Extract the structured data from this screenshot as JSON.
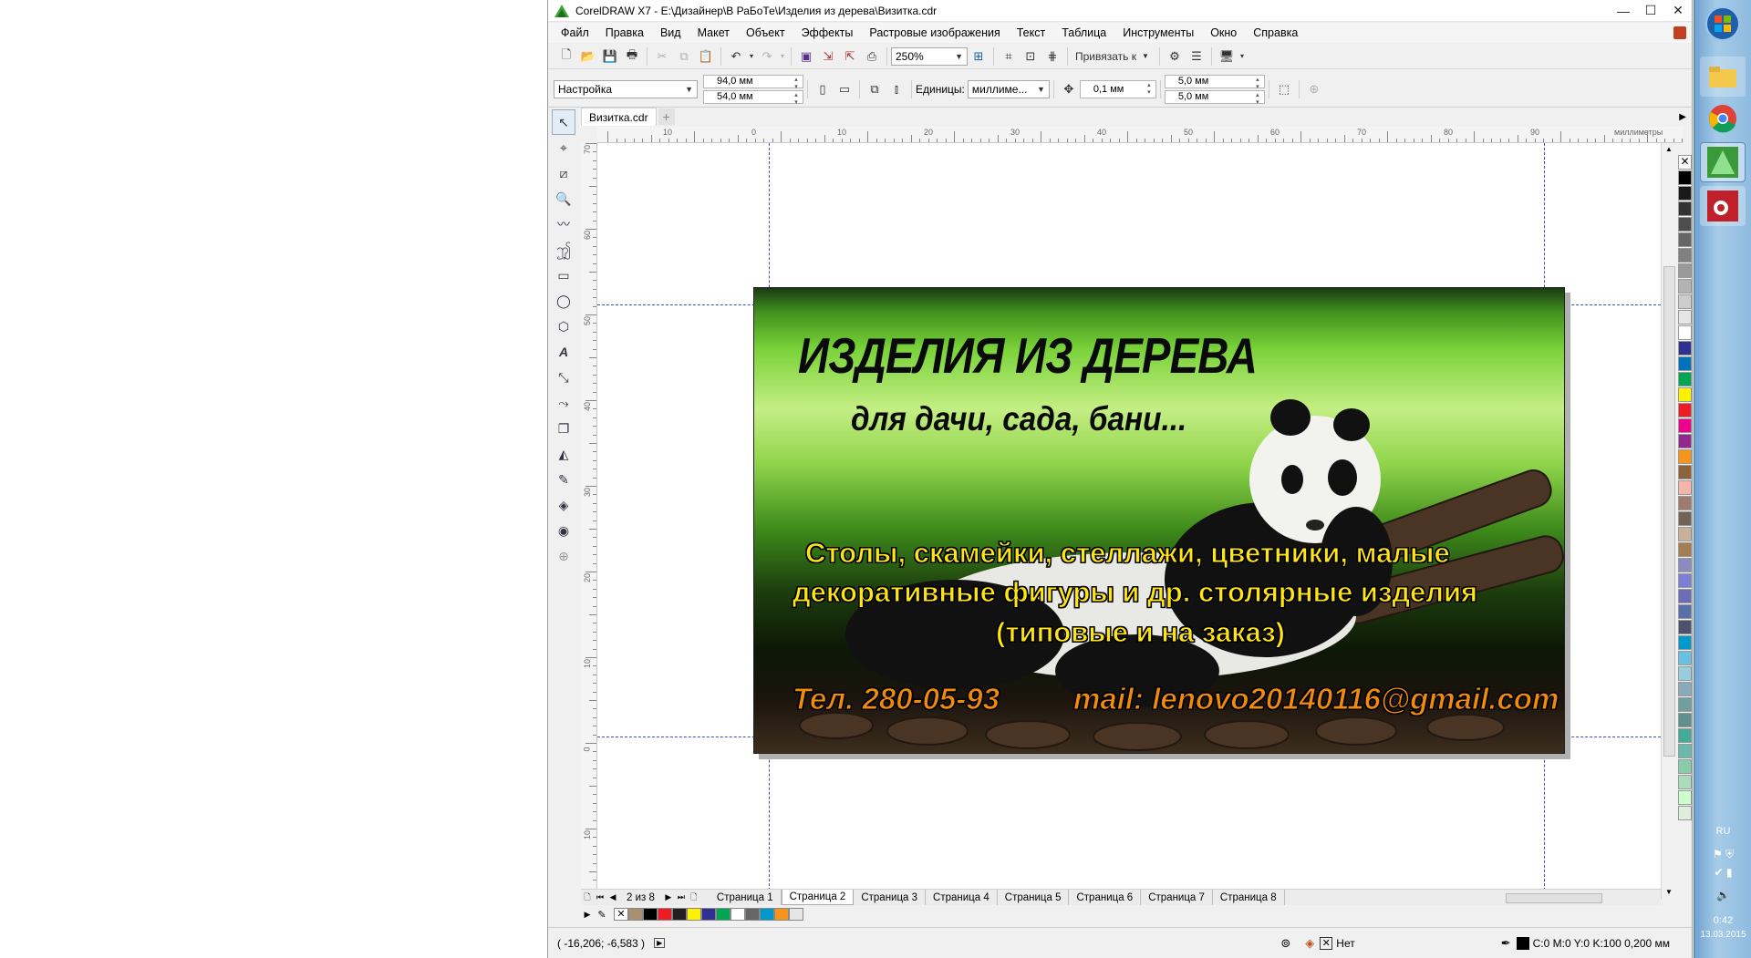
{
  "window": {
    "title": "CorelDRAW X7 - E:\\Дизайнер\\В РаБоТе\\Изделия из дерева\\Визитка.cdr",
    "minimize": "—",
    "maximize": "☐",
    "close": "✕"
  },
  "menu": [
    "Файл",
    "Правка",
    "Вид",
    "Макет",
    "Объект",
    "Эффекты",
    "Растровые изображения",
    "Текст",
    "Таблица",
    "Инструменты",
    "Окно",
    "Справка"
  ],
  "standard_toolbar": {
    "zoom_value": "250%",
    "snap_label": "Привязать к"
  },
  "property_bar": {
    "preset": "Настройка",
    "width": "94,0 мм",
    "height": "54,0 мм",
    "units_label": "Единицы:",
    "units_value": "миллиме...",
    "nudge": "0,1 мм",
    "dup_x": "5,0 мм",
    "dup_y": "5,0 мм"
  },
  "document_tab": "Визитка.cdr",
  "ruler": {
    "unit_label": "миллиметры",
    "h_labels": [
      "10",
      "0",
      "10",
      "20",
      "30",
      "40",
      "50",
      "60",
      "70",
      "80",
      "90"
    ],
    "v_labels": [
      "70",
      "60",
      "50",
      "40",
      "30",
      "20",
      "10",
      "0",
      "10"
    ]
  },
  "card": {
    "title": "ИЗДЕЛИЯ ИЗ ДЕРЕВА",
    "subtitle": "для дачи, сада, бани...",
    "line1": "Столы, скамейки, стеллажи, цветники,  малые",
    "line2": "декоративные фигуры и др. столярные изделия",
    "line3": "(типовые и на заказ)",
    "phone": "Тел. 280-05-93",
    "mail": "mail: lenovo20140116@gmail.com"
  },
  "pages": {
    "counter": "2 из 8",
    "tabs": [
      "Страница 1",
      "Страница 2",
      "Страница 3",
      "Страница 4",
      "Страница 5",
      "Страница 6",
      "Страница 7",
      "Страница 8"
    ],
    "active_index": 1
  },
  "status": {
    "coords": "( -16,206; -6,583 )",
    "fill": "Нет",
    "outline": "C:0 M:0 Y:0 K:100  0,200 мм"
  },
  "palette_colors": [
    "#000000",
    "#1a1a1a",
    "#333333",
    "#4d4d4d",
    "#666666",
    "#808080",
    "#999999",
    "#b3b3b3",
    "#cccccc",
    "#e6e6e6",
    "#ffffff",
    "#2e3192",
    "#0072bc",
    "#00a651",
    "#fff200",
    "#ed1c24",
    "#ec008c",
    "#92278f",
    "#f7941d",
    "#8c6239",
    "#f5b5a8",
    "#9e7b6e",
    "#736357",
    "#c7b299",
    "#a67c52",
    "#8b8bbf",
    "#7b7fd6",
    "#6c6cb8",
    "#5a6ea8",
    "#4f4f6e",
    "#0099cc",
    "#66c2e0",
    "#99ccdd",
    "#88aabb",
    "#6f9f9f",
    "#5f8f8f",
    "#44aa99",
    "#66bbaa",
    "#88ccaa",
    "#aaddbb",
    "#ccffcc",
    "#ddeedd"
  ],
  "doc_palette": [
    "#a89070",
    "#000000",
    "#ed1c24",
    "#231f20",
    "#fff200",
    "#2e3192",
    "#00a651",
    "#ffffff",
    "#666666",
    "#0099cc",
    "#f7941d",
    "#e6e6e6"
  ],
  "taskbar": {
    "lang": "RU",
    "time": "0:42",
    "date": "13.03.2015"
  }
}
